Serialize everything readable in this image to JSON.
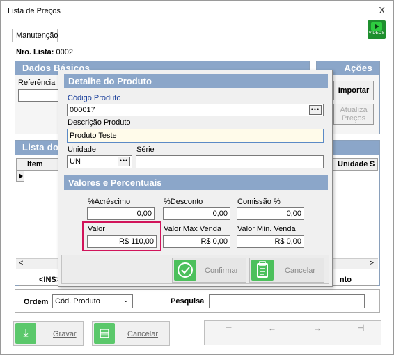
{
  "window": {
    "title": "Lista de Preços",
    "close": "X"
  },
  "tab": {
    "label": "Manutenção"
  },
  "videos_label": "VÍDEOS",
  "nro_lista": {
    "label": "Nro. Lista:",
    "value": "0002"
  },
  "dados_basicos": {
    "title": "Dados Básicos",
    "referencia_label": "Referência"
  },
  "acoes": {
    "title": "Ações",
    "importar": "Importar",
    "atualiza_precos": "Atualiza Preços"
  },
  "lista": {
    "title": "Lista dos",
    "columns": [
      "Item",
      "Unidade",
      "S"
    ],
    "footer_left": "<INS>",
    "footer_right": "nto"
  },
  "ordem": {
    "label": "Ordem",
    "value": "Cód. Produto",
    "pesquisa_label": "Pesquisa",
    "pesquisa_value": ""
  },
  "bottom": {
    "gravar": "Gravar",
    "cancelar": "Cancelar"
  },
  "nav": [
    "⊢",
    "←",
    "→",
    "⊣"
  ],
  "modal": {
    "title": "Detalhe do Produto",
    "codigo_label": "Código Produto",
    "codigo_value": "000017",
    "descricao_label": "Descrição Produto",
    "descricao_value": "Produto Teste",
    "unidade_label": "Unidade",
    "unidade_value": "UN",
    "serie_label": "Série",
    "serie_value": "",
    "section2_title": "Valores e Percentuais",
    "acrescimo_label": "%Acréscimo",
    "acrescimo_value": "0,00",
    "desconto_label": "%Desconto",
    "desconto_value": "0,00",
    "comissao_label": "Comissão %",
    "comissao_value": "0,00",
    "valor_label": "Valor",
    "valor_value": "R$ 110,00",
    "valor_max_label": "Valor Máx Venda",
    "valor_max_value": "R$ 0,00",
    "valor_min_label": "Valor Mín. Venda",
    "valor_min_value": "R$ 0,00",
    "confirmar": "Confirmar",
    "cancelar": "Cancelar"
  },
  "colors": {
    "panel_header": "#8ba6c9",
    "highlight": "#d1145a",
    "icon_green": "#4cc05c"
  }
}
